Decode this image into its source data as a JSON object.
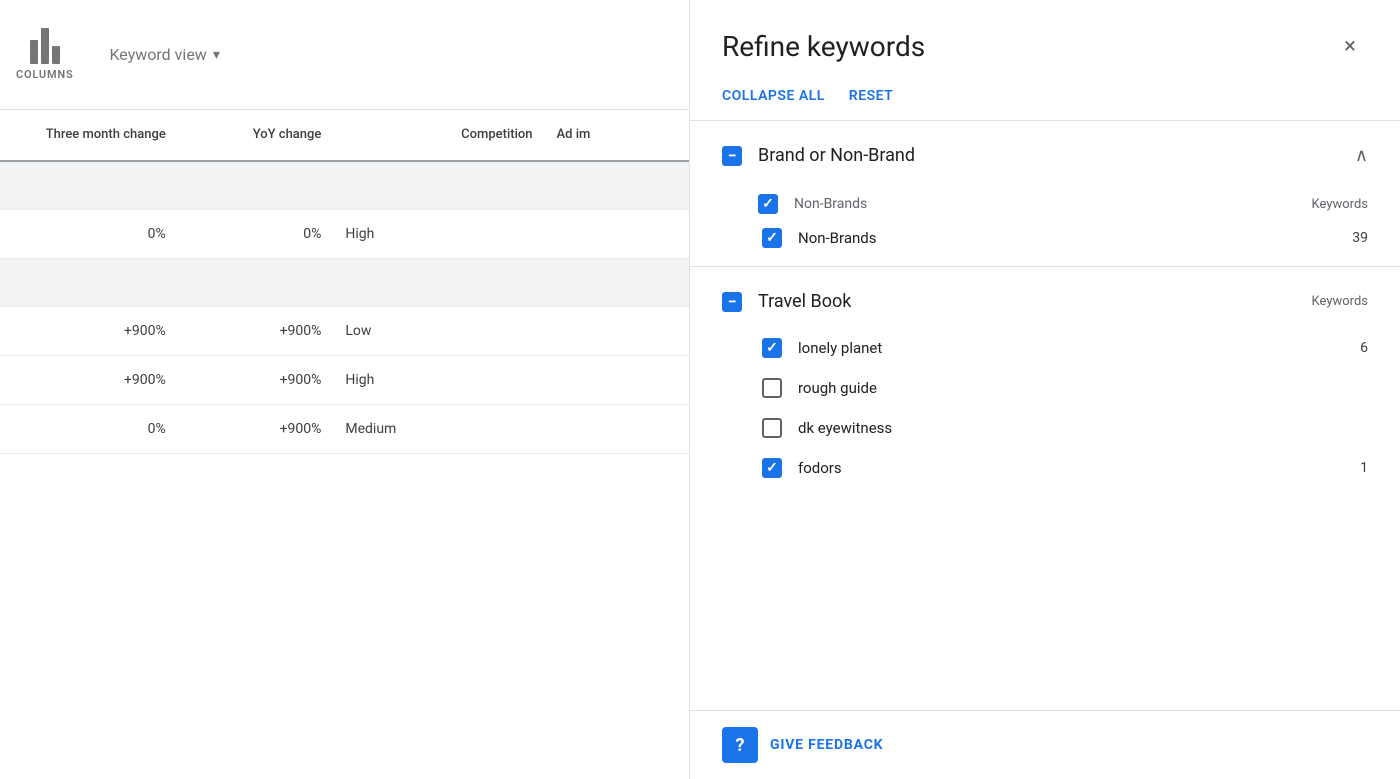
{
  "toolbar": {
    "columns_label": "COLUMNS",
    "keyword_view_label": "Keyword view"
  },
  "table": {
    "headers": {
      "three_month": "Three month change",
      "yoy": "YoY change",
      "competition": "Competition",
      "ad_impression": "Ad im"
    },
    "groups": [
      {
        "id": "group1",
        "rows": [
          {
            "three_month": "0%",
            "yoy": "0%",
            "competition": "High"
          }
        ]
      },
      {
        "id": "group2",
        "rows": [
          {
            "three_month": "+900%",
            "yoy": "+900%",
            "competition": "Low"
          },
          {
            "three_month": "+900%",
            "yoy": "+900%",
            "competition": "High"
          },
          {
            "three_month": "0%",
            "yoy": "+900%",
            "competition": "Medium"
          }
        ]
      }
    ]
  },
  "refine_panel": {
    "title": "Refine keywords",
    "close_label": "×",
    "collapse_all_label": "COLLAPSE ALL",
    "reset_label": "RESET",
    "sections": [
      {
        "id": "brand-or-non-brand",
        "title": "Brand or Non-Brand",
        "expanded": true,
        "state": "indeterminate",
        "groups": [
          {
            "id": "non-brands-group",
            "label": "Non-Brands",
            "keywords_label": "Keywords",
            "state": "checked",
            "items": [
              {
                "id": "non-brands",
                "label": "Non-Brands",
                "count": "39",
                "state": "checked"
              }
            ]
          }
        ]
      },
      {
        "id": "travel-book",
        "title": "Travel Book",
        "expanded": true,
        "state": "indeterminate",
        "groups": [
          {
            "id": "travel-book-group",
            "label": "",
            "keywords_label": "Keywords",
            "state": "indeterminate",
            "items": [
              {
                "id": "lonely-planet",
                "label": "lonely planet",
                "count": "6",
                "state": "checked"
              },
              {
                "id": "rough-guide",
                "label": "rough guide",
                "count": "",
                "state": "unchecked"
              },
              {
                "id": "dk-eyewitness",
                "label": "dk eyewitness",
                "count": "",
                "state": "unchecked"
              },
              {
                "id": "fodors",
                "label": "fodors",
                "count": "1",
                "state": "checked"
              }
            ]
          }
        ]
      }
    ],
    "feedback": {
      "icon_label": "?",
      "text": "GIVE FEEDBACK"
    }
  }
}
